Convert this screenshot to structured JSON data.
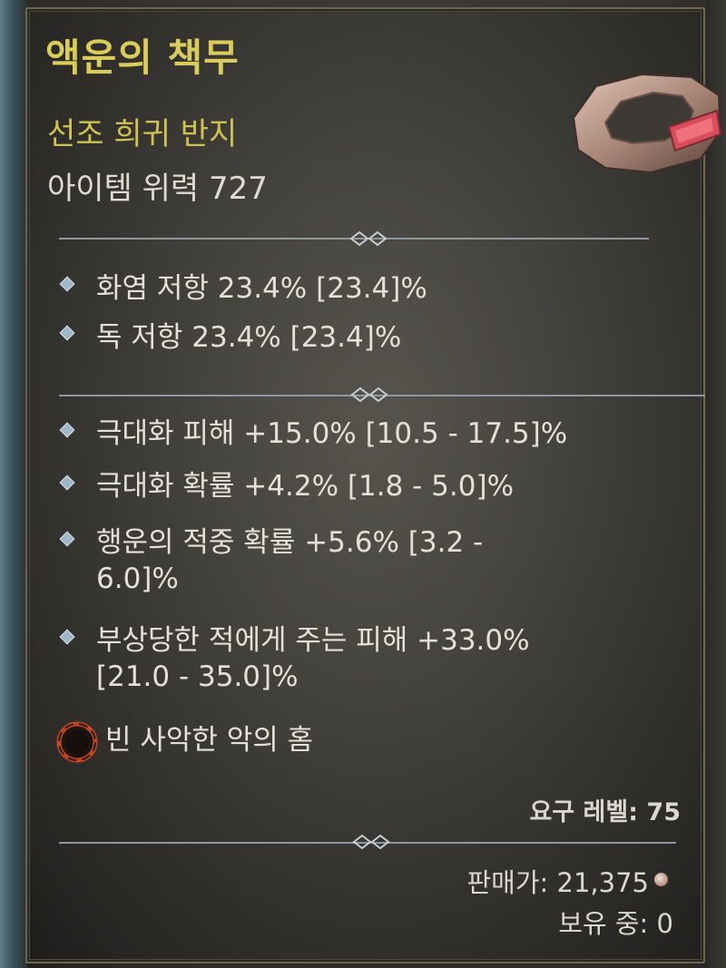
{
  "item": {
    "name": "액운의 책무",
    "type": "선조 희귀 반지",
    "power": "아이템 위력 727"
  },
  "resists": [
    "화염 저항 23.4% [23.4]%",
    "독 저항 23.4% [23.4]%"
  ],
  "affixes": [
    {
      "line1": "극대화 피해 +15.0% [10.5 - 17.5]%",
      "line2": ""
    },
    {
      "line1": "극대화 확률 +4.2% [1.8 - 5.0]%",
      "line2": ""
    },
    {
      "line1": "행운의 적중 확률 +5.6% [3.2 -",
      "line2": "6.0]%"
    },
    {
      "line1": "부상당한 적에게 주는 피해 +33.0%",
      "line2": "[21.0 - 35.0]%"
    }
  ],
  "socket": {
    "label": "빈 사악한 악의 홈",
    "icon": "empty-socket-icon"
  },
  "footer": {
    "required_level": "요구 레벨: 75",
    "sell_price": "판매가: 21,375",
    "owned": "보유 중: 0",
    "currency_icon": "gold-coin-icon"
  },
  "colors": {
    "title": "#d9cc5a",
    "text": "#e4e1d8",
    "bullet": "#9fb8c8"
  }
}
